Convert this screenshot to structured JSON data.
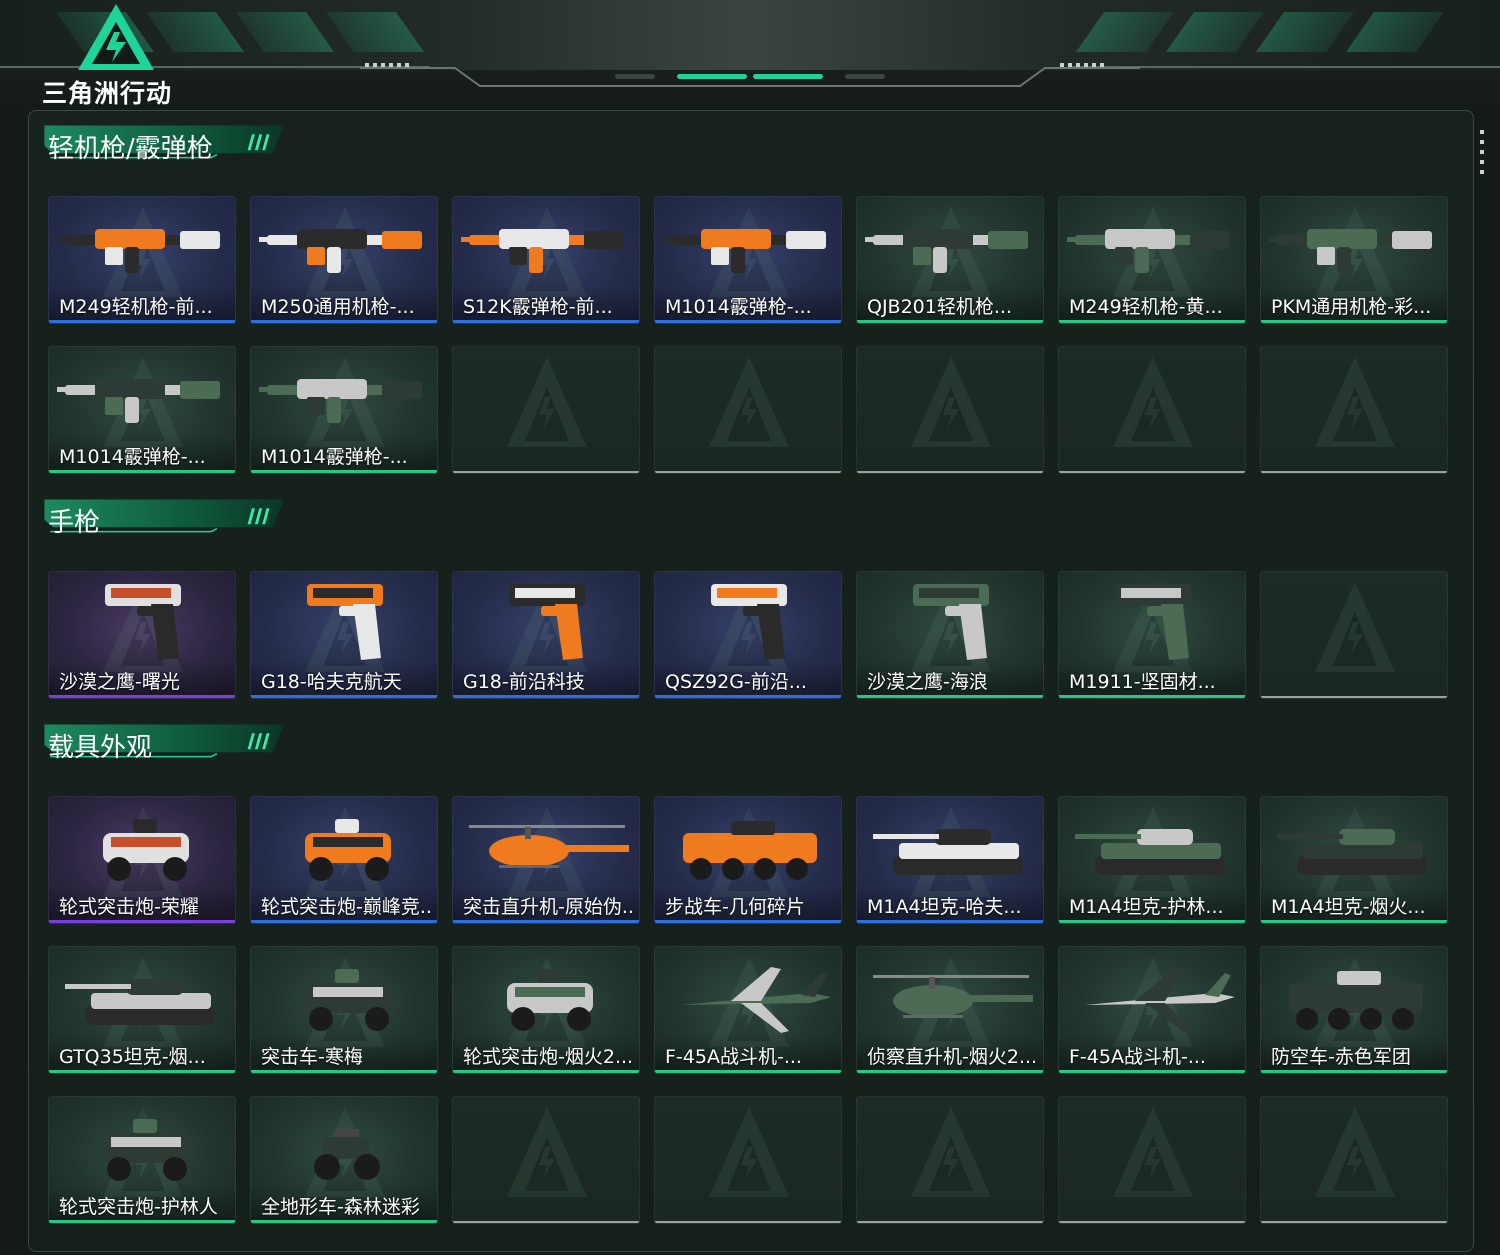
{
  "app": {
    "logo_text": "三角洲行动"
  },
  "colors": {
    "purple": "#7b3fe0",
    "blue": "#2d6ee0",
    "green": "#29c784",
    "empty": "#9aa29e",
    "accent": "#1fd39a"
  },
  "sections": [
    {
      "title": "轻机枪/霰弹枪",
      "items": [
        {
          "label": "M249轻机枪-前...",
          "rarity": "blue",
          "icon": "lmg-icon"
        },
        {
          "label": "M250通用机枪-...",
          "rarity": "blue",
          "icon": "lmg-icon"
        },
        {
          "label": "S12K霰弹枪-前...",
          "rarity": "blue",
          "icon": "shotgun-icon"
        },
        {
          "label": "M1014霰弹枪-...",
          "rarity": "blue",
          "icon": "shotgun-icon"
        },
        {
          "label": "QJB201轻机枪...",
          "rarity": "green",
          "icon": "lmg-icon"
        },
        {
          "label": "M249轻机枪-黄...",
          "rarity": "green",
          "icon": "lmg-icon"
        },
        {
          "label": "PKM通用机枪-彩...",
          "rarity": "green",
          "icon": "lmg-icon"
        },
        {
          "label": "M1014霰弹枪-...",
          "rarity": "green",
          "icon": "shotgun-icon"
        },
        {
          "label": "M1014霰弹枪-...",
          "rarity": "green",
          "icon": "shotgun-icon"
        },
        {
          "label": "",
          "rarity": "empty"
        },
        {
          "label": "",
          "rarity": "empty"
        },
        {
          "label": "",
          "rarity": "empty"
        },
        {
          "label": "",
          "rarity": "empty"
        },
        {
          "label": "",
          "rarity": "empty"
        }
      ]
    },
    {
      "title": "手枪",
      "items": [
        {
          "label": "沙漠之鹰-曙光",
          "rarity": "purple",
          "icon": "pistol-icon"
        },
        {
          "label": "G18-哈夫克航天",
          "rarity": "blue",
          "icon": "pistol-icon"
        },
        {
          "label": "G18-前沿科技",
          "rarity": "blue",
          "icon": "pistol-icon"
        },
        {
          "label": "QSZ92G-前沿...",
          "rarity": "blue",
          "icon": "pistol-icon"
        },
        {
          "label": "沙漠之鹰-海浪",
          "rarity": "green",
          "icon": "pistol-icon"
        },
        {
          "label": "M1911-坚固材...",
          "rarity": "green",
          "icon": "pistol-icon"
        },
        {
          "label": "",
          "rarity": "empty"
        }
      ]
    },
    {
      "title": "载具外观",
      "items": [
        {
          "label": "轮式突击炮-荣耀",
          "rarity": "purple",
          "icon": "armored-car-icon"
        },
        {
          "label": "轮式突击炮-巅峰竞...",
          "rarity": "blue",
          "icon": "armored-car-icon"
        },
        {
          "label": "突击直升机-原始伪...",
          "rarity": "blue",
          "icon": "helicopter-icon"
        },
        {
          "label": "步战车-几何碎片",
          "rarity": "blue",
          "icon": "ifv-icon"
        },
        {
          "label": "M1A4坦克-哈夫...",
          "rarity": "blue",
          "icon": "tank-icon"
        },
        {
          "label": "M1A4坦克-护林...",
          "rarity": "green",
          "icon": "tank-icon"
        },
        {
          "label": "M1A4坦克-烟火...",
          "rarity": "green",
          "icon": "tank-icon"
        },
        {
          "label": "GTQ35坦克-烟...",
          "rarity": "green",
          "icon": "tank-icon"
        },
        {
          "label": "突击车-寒梅",
          "rarity": "green",
          "icon": "armored-car-icon"
        },
        {
          "label": "轮式突击炮-烟火2...",
          "rarity": "green",
          "icon": "armored-car-icon"
        },
        {
          "label": "F-45A战斗机-...",
          "rarity": "green",
          "icon": "jet-icon"
        },
        {
          "label": "侦察直升机-烟火2...",
          "rarity": "green",
          "icon": "helicopter-icon"
        },
        {
          "label": "F-45A战斗机-...",
          "rarity": "green",
          "icon": "jet-icon"
        },
        {
          "label": "防空车-赤色军团",
          "rarity": "green",
          "icon": "ifv-icon"
        },
        {
          "label": "轮式突击炮-护林人",
          "rarity": "green",
          "icon": "armored-car-icon"
        },
        {
          "label": "全地形车-森林迷彩",
          "rarity": "green",
          "icon": "atv-icon"
        },
        {
          "label": "",
          "rarity": "empty"
        },
        {
          "label": "",
          "rarity": "empty"
        },
        {
          "label": "",
          "rarity": "empty"
        },
        {
          "label": "",
          "rarity": "empty"
        },
        {
          "label": "",
          "rarity": "empty"
        }
      ]
    }
  ]
}
